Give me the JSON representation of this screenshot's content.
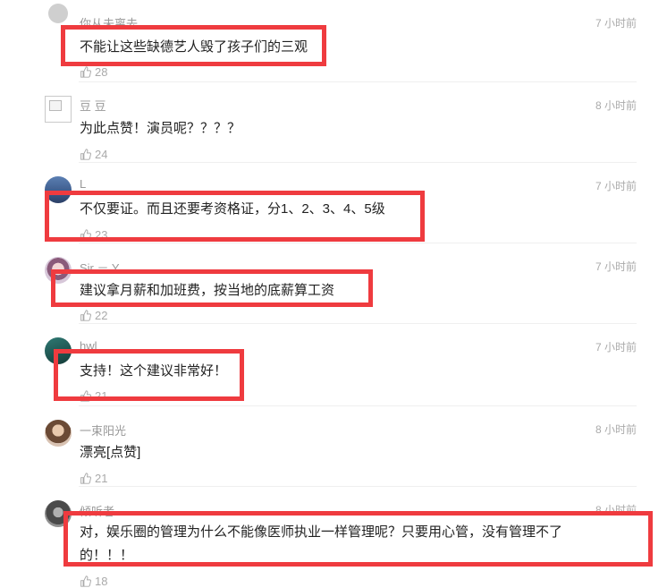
{
  "comments": [
    {
      "user": "你从未离去",
      "time": "7 小时前",
      "text": "不能让这些缺德艺人毁了孩子们的三观",
      "likes": "28"
    },
    {
      "user": "豆 豆",
      "time": "8 小时前",
      "text": "为此点赞！演员呢？？？？",
      "likes": "24"
    },
    {
      "user": "L",
      "time": "7 小时前",
      "text": "不仅要证。而且还要考资格证，分1、2、3、4、5级",
      "likes": "23"
    },
    {
      "user": "Sir － Y",
      "time": "7 小时前",
      "text": "建议拿月薪和加班费，按当地的底薪算工资",
      "likes": "22"
    },
    {
      "user": "hwl",
      "time": "7 小时前",
      "text": "支持！这个建议非常好！",
      "likes": "21"
    },
    {
      "user": "一束阳光",
      "time": "8 小时前",
      "text": "漂亮[点赞]",
      "likes": "21"
    },
    {
      "user": "倾听者",
      "time": "8 小时前",
      "text_line1": "对，娱乐圈的管理为什么不能像医师执业一样管理呢？只要用心管，没有管理不了",
      "text_line2": "的！！！",
      "likes": "18"
    }
  ],
  "colors": {
    "highlight": "#ef3b3f",
    "meta": "#999999",
    "text": "#222222"
  },
  "icons": {
    "like": "thumbs-up-icon",
    "broken_avatar": "broken-image-icon"
  }
}
